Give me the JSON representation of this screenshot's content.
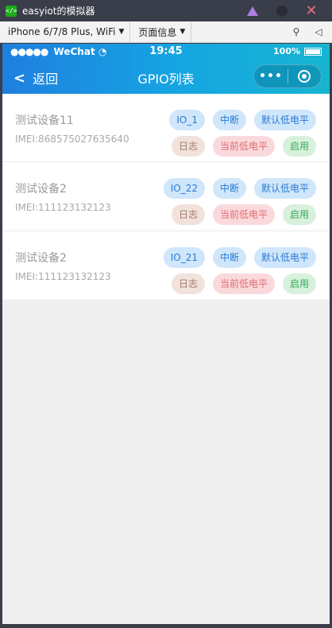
{
  "window": {
    "title": "easyiot的模拟器",
    "app_icon_text": "</>"
  },
  "toolbar": {
    "device_select": "iPhone 6/7/8 Plus, WiFi",
    "page_info": "页面信息"
  },
  "statusbar": {
    "carrier": "WeChat",
    "signal_dots": "●●●●●",
    "time": "19:45",
    "battery": "100%",
    "battery_level": 1.0
  },
  "navbar": {
    "back_label": "返回",
    "title": "GPIO列表",
    "more_label": "•••"
  },
  "colors": {
    "nav_gradient_start": "#1f7fe0",
    "nav_gradient_end": "#17b5d0",
    "tag_blue": "#2a7bd4",
    "tag_pink": "#e06b74",
    "tag_green": "#3aa857"
  },
  "devices": [
    {
      "name": "测试设备11",
      "imei": "IMEI:868575027635640",
      "io": "IO_1",
      "mode": "中断",
      "default_level": "默认低电平",
      "log": "日志",
      "current_level": "当前低电平",
      "status": "启用"
    },
    {
      "name": "测试设备2",
      "imei": "IMEI:111123132123",
      "io": "IO_22",
      "mode": "中断",
      "default_level": "默认低电平",
      "log": "日志",
      "current_level": "当前低电平",
      "status": "启用"
    },
    {
      "name": "测试设备2",
      "imei": "IMEI:111123132123",
      "io": "IO_21",
      "mode": "中断",
      "default_level": "默认低电平",
      "log": "日志",
      "current_level": "当前低电平",
      "status": "启用"
    }
  ]
}
